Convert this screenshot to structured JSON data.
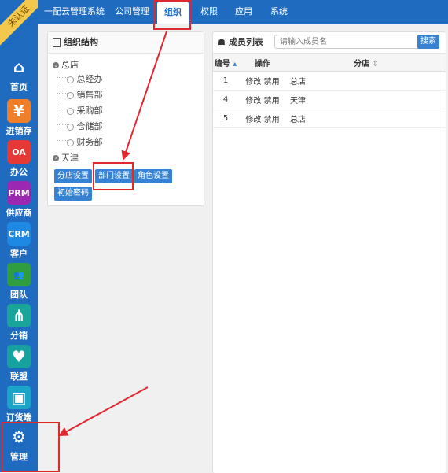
{
  "badge": "未认证",
  "sidebar": [
    {
      "label": "首页",
      "icon": "home-icon",
      "glyph": "⌂",
      "color": "#1f6bc0"
    },
    {
      "label": "进销存",
      "icon": "yen-icon",
      "glyph": "¥",
      "color": "#f07f2b"
    },
    {
      "label": "办公",
      "icon": "oa-icon",
      "glyph": "OA",
      "color": "#e53935"
    },
    {
      "label": "供应商",
      "icon": "prm-icon",
      "glyph": "PRM",
      "color": "#9c27b0"
    },
    {
      "label": "客户",
      "icon": "crm-icon",
      "glyph": "CRM",
      "color": "#1e88e5"
    },
    {
      "label": "团队",
      "icon": "team-icon",
      "glyph": "👥",
      "color": "#2e9e3e"
    },
    {
      "label": "分销",
      "icon": "distribution-icon",
      "glyph": "⋔",
      "color": "#1aa59a"
    },
    {
      "label": "联盟",
      "icon": "alliance-icon",
      "glyph": "♥",
      "color": "#17a2a0"
    },
    {
      "label": "订货端",
      "icon": "order-icon",
      "glyph": "▣",
      "color": "#1aa5c8"
    },
    {
      "label": "管理",
      "icon": "gear-icon",
      "glyph": "⚙",
      "color": "#1f6bc0"
    }
  ],
  "topnav": {
    "brand": "一配云管理系统",
    "tabs": [
      "公司管理",
      "组织",
      "权限",
      "应用",
      "系统"
    ]
  },
  "org": {
    "title": "组织结构",
    "root": "总店",
    "children": [
      "总经办",
      "销售部",
      "采购部",
      "仓储部",
      "财务部"
    ],
    "second": "天津",
    "buttons": [
      "分店设置",
      "部门设置",
      "角色设置",
      "初始密码"
    ]
  },
  "members": {
    "title": "成员列表",
    "search_placeholder": "请输入成员名",
    "search_button": "搜索",
    "columns": [
      "编号",
      "操作",
      "分店"
    ],
    "rows": [
      {
        "id": "1",
        "edit": "修改",
        "disable": "禁用",
        "branch": "总店"
      },
      {
        "id": "4",
        "edit": "修改",
        "disable": "禁用",
        "branch": "天津"
      },
      {
        "id": "5",
        "edit": "修改",
        "disable": "禁用",
        "branch": "总店"
      }
    ]
  }
}
